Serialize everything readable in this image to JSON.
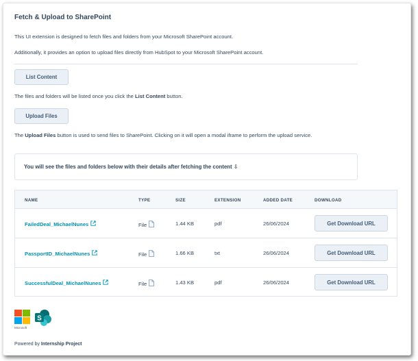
{
  "header": {
    "title": "Fetch & Upload to SharePoint"
  },
  "intro": {
    "line1": "This UI extension is designed to fetch files and folders from your Microsoft SharePoint account.",
    "line2": "Additionally, it provides an option to upload files directly from HubSpot to your Microsoft SharePoint account."
  },
  "list_section": {
    "button_label": "List Content",
    "desc_prefix": "The files and folders will be listed once you click the ",
    "desc_bold": "List Content",
    "desc_suffix": " button."
  },
  "upload_section": {
    "button_label": "Upload Files",
    "desc_prefix": "The ",
    "desc_bold": "Upload Files",
    "desc_suffix": " button is used to send files to SharePoint. Clicking on it will open a modal iframe to perform the upload service."
  },
  "notice": {
    "text": "You will see the files and folders below with their details after fetching the content ⇩"
  },
  "table": {
    "headers": {
      "name": "NAME",
      "type": "TYPE",
      "size": "SIZE",
      "extension": "EXTENSION",
      "added_date": "ADDED DATE",
      "download": "DOWNLOAD"
    },
    "rows": [
      {
        "name": "FailedDeal_MichaelNunes",
        "type": "File",
        "size": "1.44 KB",
        "extension": "pdf",
        "added_date": "26/06/2024",
        "download_label": "Get Download URL"
      },
      {
        "name": "PassportID_MichaelNunes",
        "type": "File",
        "size": "1.66 KB",
        "extension": "txt",
        "added_date": "26/06/2024",
        "download_label": "Get Download URL"
      },
      {
        "name": "SuccessfulDeal_MichaelNunes",
        "type": "File",
        "size": "1.43 KB",
        "extension": "pdf",
        "added_date": "26/06/2024",
        "download_label": "Get Download URL"
      }
    ]
  },
  "footer": {
    "microsoft_logo_text": "Microsoft",
    "powered_prefix": "Powered by ",
    "powered_bold": "Internship Project"
  },
  "colors": {
    "link": "#0091ae",
    "text": "#33475b",
    "button_bg": "#eaf0f6",
    "button_border": "#cbd6e2",
    "ms_red": "#f25022",
    "ms_green": "#7fba00",
    "ms_blue": "#00a4ef",
    "ms_yellow": "#ffb900",
    "sharepoint": "#038387"
  }
}
